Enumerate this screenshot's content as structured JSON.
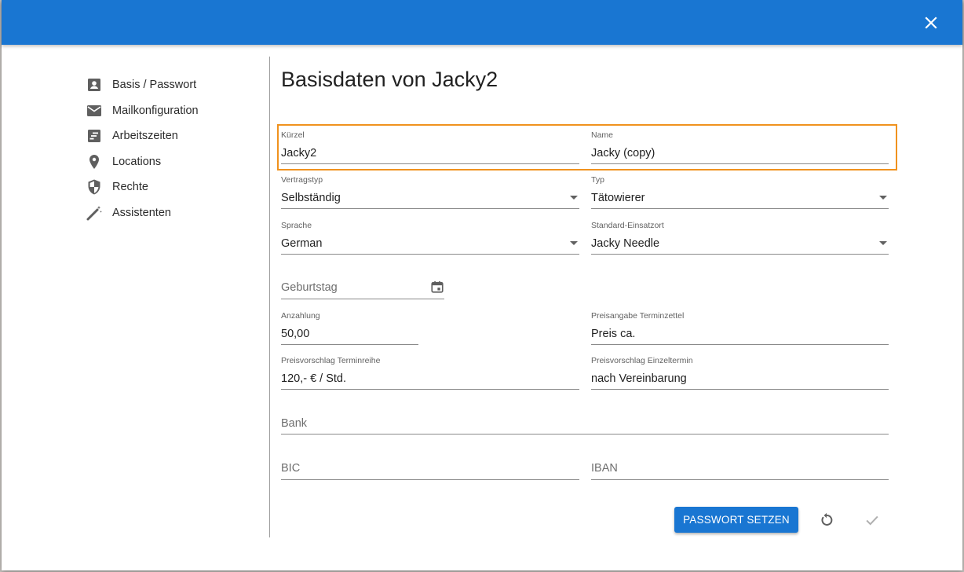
{
  "dialog": {
    "close_icon": "close-icon",
    "accent_color": "#1976d2",
    "highlight_color": "#f0921e"
  },
  "sidebar": {
    "items": [
      {
        "label": "Basis / Passwort",
        "icon": "account-box-icon"
      },
      {
        "label": "Mailkonfiguration",
        "icon": "mail-icon"
      },
      {
        "label": "Arbeitszeiten",
        "icon": "schedule-list-icon"
      },
      {
        "label": "Locations",
        "icon": "location-pin-icon"
      },
      {
        "label": "Rechte",
        "icon": "shield-icon"
      },
      {
        "label": "Assistenten",
        "icon": "magic-wand-icon"
      }
    ]
  },
  "main": {
    "title": "Basisdaten von Jacky2",
    "fields": {
      "kuerzel": {
        "label": "Kürzel",
        "value": "Jacky2"
      },
      "name": {
        "label": "Name",
        "value": "Jacky (copy)"
      },
      "vertragstyp": {
        "label": "Vertragstyp",
        "value": "Selbständig"
      },
      "typ": {
        "label": "Typ",
        "value": "Tätowierer"
      },
      "sprache": {
        "label": "Sprache",
        "value": "German"
      },
      "einsatzort": {
        "label": "Standard-Einsatzort",
        "value": "Jacky Needle"
      },
      "geburtstag": {
        "placeholder": "Geburtstag"
      },
      "anzahlung": {
        "label": "Anzahlung",
        "value": "50,00"
      },
      "preisangabe": {
        "label": "Preisangabe Terminzettel",
        "value": "Preis ca."
      },
      "terminreihe": {
        "label": "Preisvorschlag Terminreihe",
        "value": "120,- € / Std."
      },
      "einzeltermin": {
        "label": "Preisvorschlag Einzeltermin",
        "value": "nach Vereinbarung"
      },
      "bank": {
        "placeholder": "Bank"
      },
      "bic": {
        "placeholder": "BIC"
      },
      "iban": {
        "placeholder": "IBAN"
      }
    },
    "actions": {
      "set_password_label": "PASSWORT SETZEN",
      "reset_icon": "refresh-icon",
      "save_icon": "check-icon"
    }
  }
}
